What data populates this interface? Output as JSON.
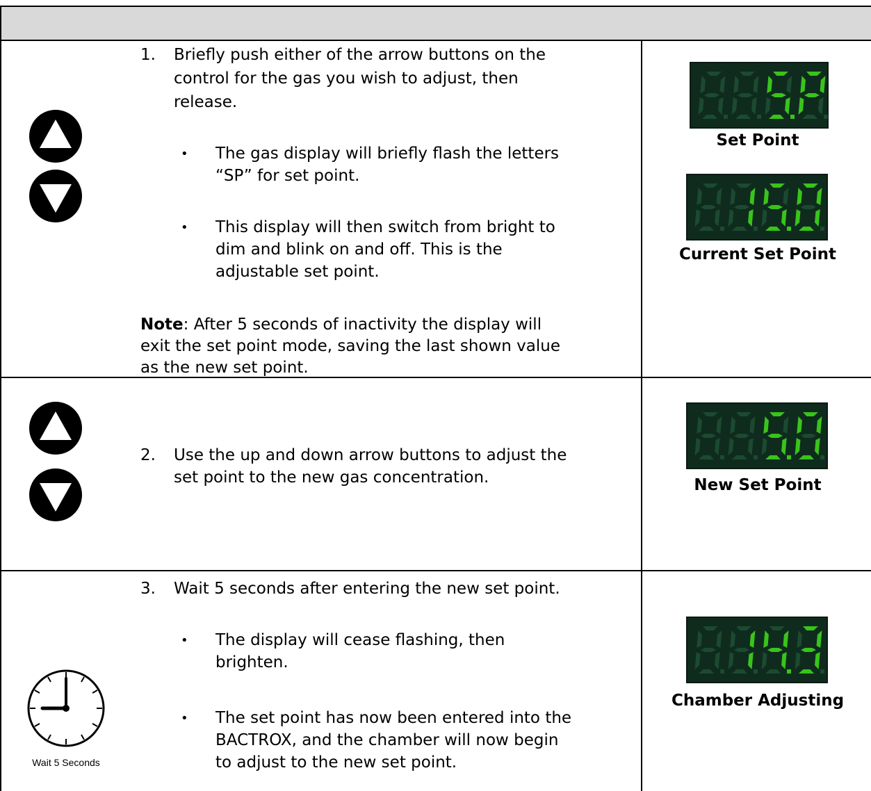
{
  "rows": [
    {
      "step_number": "1.",
      "step_lines": [
        "Briefly push either of the arrow buttons on the",
        "control for the gas you wish to adjust, then",
        "release."
      ],
      "bullets": [
        {
          "lines": [
            "The gas display will briefly flash the letters",
            "“SP” for set point."
          ]
        },
        {
          "lines": [
            "This display will then switch from bright to",
            "dim and blink on and off. This is the",
            "adjustable set point."
          ]
        }
      ],
      "note": {
        "label": "Note",
        "lines": [
          ": After 5 seconds of inactivity the display will",
          "exit the set point mode, saving the last shown value",
          "as the new set point."
        ]
      },
      "displays": [
        {
          "caption": "Set Point",
          "digits": [
            "8",
            "S.",
            "P"
          ]
        },
        {
          "caption": "Current Set Point",
          "digits": [
            "8",
            "1",
            "5.",
            "0"
          ]
        }
      ]
    },
    {
      "step_number": "2.",
      "step_lines": [
        "Use the up and down arrow buttons to adjust the",
        "set point to the new gas concentration."
      ],
      "displays": [
        {
          "caption": "New Set Point",
          "digits": [
            "8",
            "5.",
            "0"
          ]
        }
      ]
    },
    {
      "step_number": "3.",
      "step_lines": [
        "Wait 5 seconds after entering the new set point."
      ],
      "bullets": [
        {
          "lines": [
            "The display will cease flashing, then",
            "brighten."
          ]
        },
        {
          "lines": [
            "The set point has now been entered into the",
            "BACTROX, and the chamber will now begin",
            "to adjust to the new set point."
          ]
        }
      ],
      "clock_label": "Wait 5 Seconds",
      "displays": [
        {
          "caption": "Chamber Adjusting",
          "digits": [
            "8",
            "1",
            "4.",
            "3"
          ]
        }
      ]
    }
  ],
  "colors": {
    "header_band": "#d9d9d9",
    "display_bg": "#0f2b1e",
    "segment_on": "#39c41b",
    "segment_off": "#1c4a30"
  },
  "icons": [
    "up-arrow-button-icon",
    "down-arrow-button-icon",
    "clock-icon"
  ]
}
